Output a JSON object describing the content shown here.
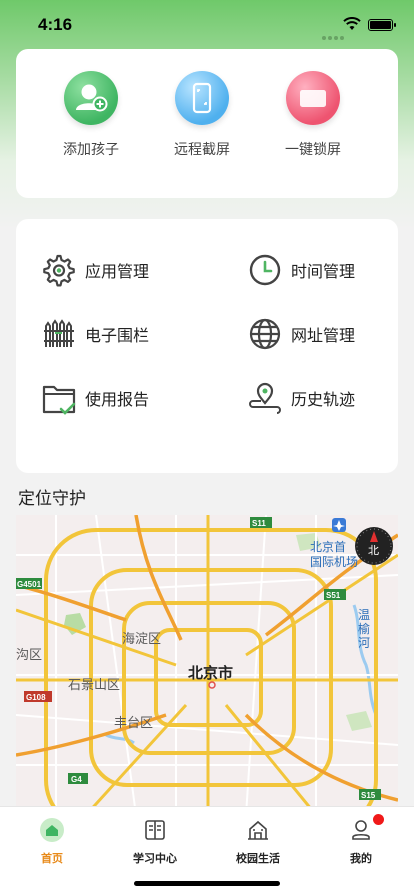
{
  "status": {
    "time": "4:16"
  },
  "quick_actions": [
    {
      "label": "添加孩子",
      "icon": "add-child-icon"
    },
    {
      "label": "远程截屏",
      "icon": "remote-screenshot-icon"
    },
    {
      "label": "一键锁屏",
      "icon": "lock-screen-icon"
    }
  ],
  "features": [
    {
      "label": "应用管理",
      "icon": "gear-icon"
    },
    {
      "label": "时间管理",
      "icon": "clock-icon"
    },
    {
      "label": "电子围栏",
      "icon": "fence-icon"
    },
    {
      "label": "网址管理",
      "icon": "globe-icon"
    },
    {
      "label": "使用报告",
      "icon": "report-folder-icon"
    },
    {
      "label": "历史轨迹",
      "icon": "location-pin-icon"
    }
  ],
  "section_title": "定位守护",
  "map": {
    "labels": {
      "city": "北京市",
      "haidian": "海淀区",
      "shijingshan": "石景山区",
      "fengtai": "丰台区",
      "mentougou": "沟区",
      "airport_line1": "北京首",
      "airport_line2": "国际机场",
      "river": "温榆河",
      "compass": "北"
    },
    "shields": [
      "S11",
      "S51",
      "S15",
      "G4",
      "G108",
      "G4501"
    ]
  },
  "tabs": [
    {
      "label": "首页",
      "icon": "home-icon",
      "active": true
    },
    {
      "label": "学习中心",
      "icon": "book-icon"
    },
    {
      "label": "校园生活",
      "icon": "school-icon"
    },
    {
      "label": "我的",
      "icon": "profile-icon",
      "badge": true
    }
  ],
  "colors": {
    "accent_green": "#4fb562",
    "tab_active": "#e88a1a",
    "badge_red": "#f01919"
  }
}
